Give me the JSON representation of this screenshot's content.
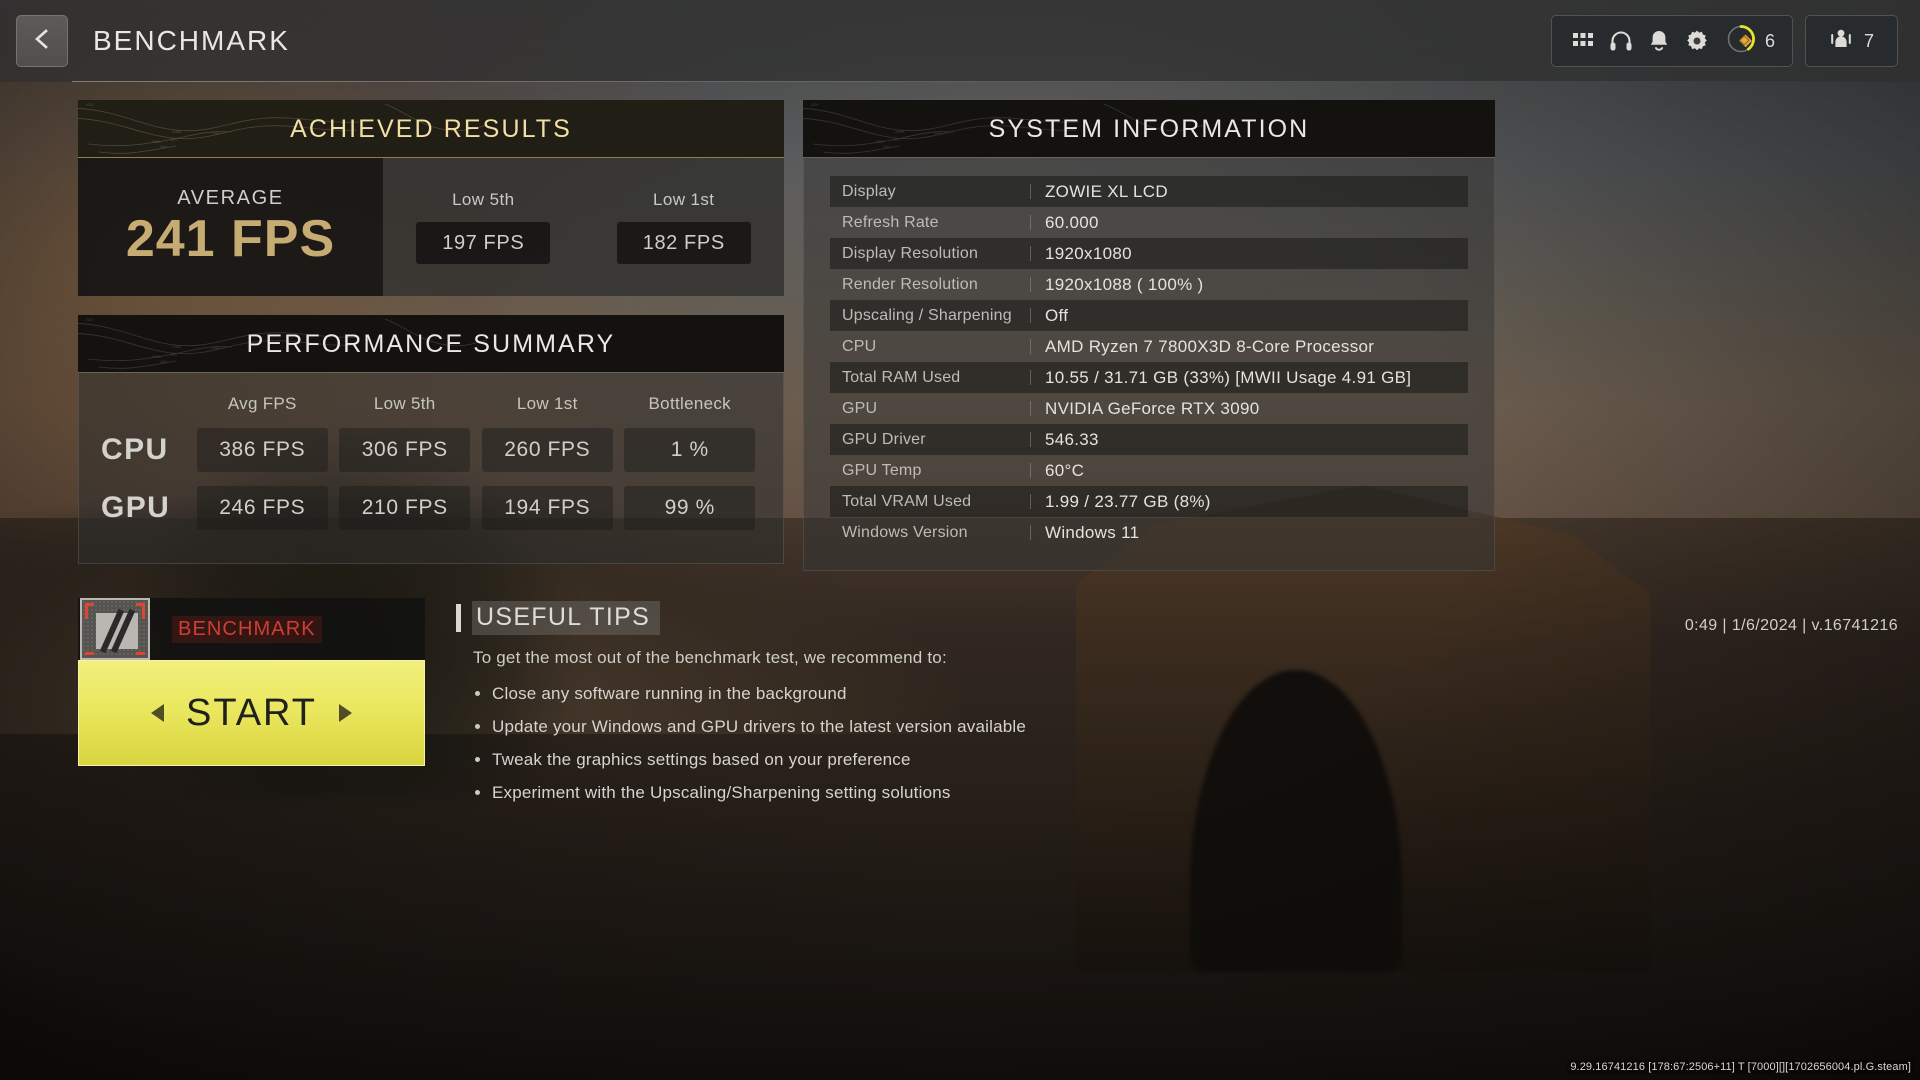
{
  "topbar": {
    "back_icon": "chevron-left-icon",
    "title": "BENCHMARK",
    "icons": [
      {
        "name": "grid-apps-icon"
      },
      {
        "name": "headset-icon"
      },
      {
        "name": "bell-icon"
      },
      {
        "name": "gear-icon"
      }
    ],
    "currency": {
      "icon": "cod-points-icon",
      "value": "6"
    },
    "party": {
      "icon": "party-members-icon",
      "value": "7"
    }
  },
  "achieved_results": {
    "title": "ACHIEVED RESULTS",
    "average_label": "AVERAGE",
    "average_value": "241 FPS",
    "lows": [
      {
        "label": "Low 5th",
        "value": "197 FPS"
      },
      {
        "label": "Low 1st",
        "value": "182 FPS"
      }
    ]
  },
  "performance_summary": {
    "title": "PERFORMANCE SUMMARY",
    "columns": [
      "Avg FPS",
      "Low 5th",
      "Low 1st",
      "Bottleneck"
    ],
    "rows": [
      {
        "label": "CPU",
        "values": [
          "386 FPS",
          "306 FPS",
          "260 FPS",
          "1 %"
        ]
      },
      {
        "label": "GPU",
        "values": [
          "246 FPS",
          "210 FPS",
          "194 FPS",
          "99 %"
        ]
      }
    ]
  },
  "system_information": {
    "title": "SYSTEM INFORMATION",
    "rows": [
      {
        "key": "Display",
        "value": "ZOWIE XL LCD"
      },
      {
        "key": "Refresh Rate",
        "value": "60.000"
      },
      {
        "key": "Display Resolution",
        "value": "1920x1080"
      },
      {
        "key": "Render Resolution",
        "value": "1920x1088 ( 100% )"
      },
      {
        "key": "Upscaling / Sharpening",
        "value": "Off"
      },
      {
        "key": "CPU",
        "value": "AMD Ryzen 7 7800X3D 8-Core Processor"
      },
      {
        "key": "Total RAM Used",
        "value": "10.55 / 31.71 GB (33%) [MWII Usage 4.91 GB]"
      },
      {
        "key": "GPU",
        "value": "NVIDIA GeForce RTX 3090"
      },
      {
        "key": "GPU Driver",
        "value": "546.33"
      },
      {
        "key": "GPU Temp",
        "value": "60°C"
      },
      {
        "key": "Total VRAM Used",
        "value": "1.99 / 23.77 GB (8%)"
      },
      {
        "key": "Windows Version",
        "value": "Windows 11"
      }
    ]
  },
  "benchmark_tile": {
    "label": "BENCHMARK",
    "thumb_icon": "benchmark-map-thumb"
  },
  "start_button": {
    "label": "START"
  },
  "tips": {
    "title": "USEFUL TIPS",
    "intro": "To get the most out of the benchmark test, we recommend to:",
    "items": [
      "Close any software running in the background",
      "Update your Windows and GPU drivers to the latest version available",
      "Tweak the graphics settings based on your preference",
      "Experiment with the Upscaling/Sharpening setting solutions"
    ]
  },
  "meta": {
    "status_line": "0:49 | 1/6/2024 | v.16741216"
  },
  "build_string": "9.29.16741216 [178:67:2506+11] T [7000][][1702656004.pl.G.steam]",
  "colors": {
    "gold": "#c6ab72",
    "title_gold": "#f2dfa4",
    "start_yellow": "#eae85f",
    "accent_red": "#cf3d35",
    "panel_dark": "#13120f"
  }
}
